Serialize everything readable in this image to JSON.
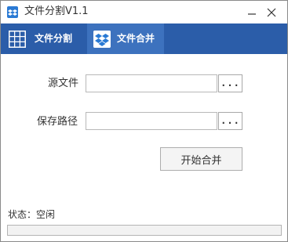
{
  "window": {
    "title": "文件分割V1.1"
  },
  "tabs": [
    {
      "label": "文件分割",
      "icon": "grid-icon",
      "active": false
    },
    {
      "label": "文件合并",
      "icon": "dropbox-icon",
      "active": true
    }
  ],
  "form": {
    "source_label": "源文件",
    "source_value": "",
    "source_browse": "...",
    "savepath_label": "保存路径",
    "savepath_value": "",
    "savepath_browse": "..."
  },
  "start_button": "开始合并",
  "status": {
    "text": "状态：空闲",
    "progress": 0
  },
  "colors": {
    "toolbar": "#2b5da9",
    "active_tab": "#3d72be",
    "icon_blue": "#2a7ad4"
  }
}
